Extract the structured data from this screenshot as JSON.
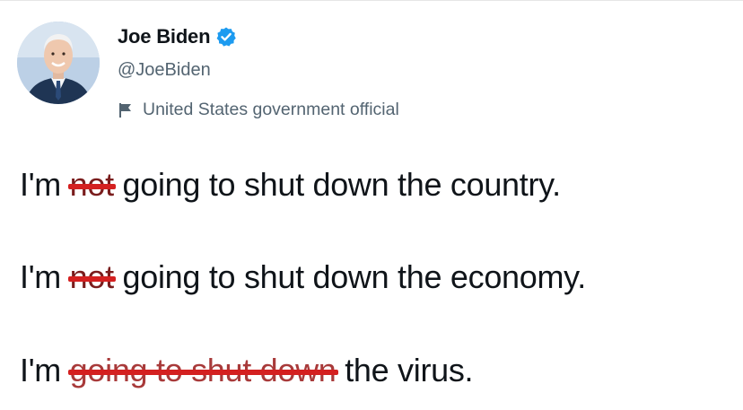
{
  "user": {
    "display_name": "Joe Biden",
    "handle": "@JoeBiden",
    "label": "United States government official",
    "verified": true,
    "verified_color": "#1d9bf0"
  },
  "tweet": {
    "lines": [
      {
        "prefix": "I'm",
        "struck": "not",
        "rest": "going to shut down the country."
      },
      {
        "prefix": "I'm",
        "struck": "not",
        "rest": "going to shut down the economy."
      },
      {
        "prefix": "I'm",
        "struck": "going to shut down",
        "rest": "the virus."
      }
    ],
    "strike_color": "#d42020"
  },
  "icons": {
    "avatar": "profile-photo",
    "verified": "verified-badge-icon",
    "label": "flag-icon"
  }
}
